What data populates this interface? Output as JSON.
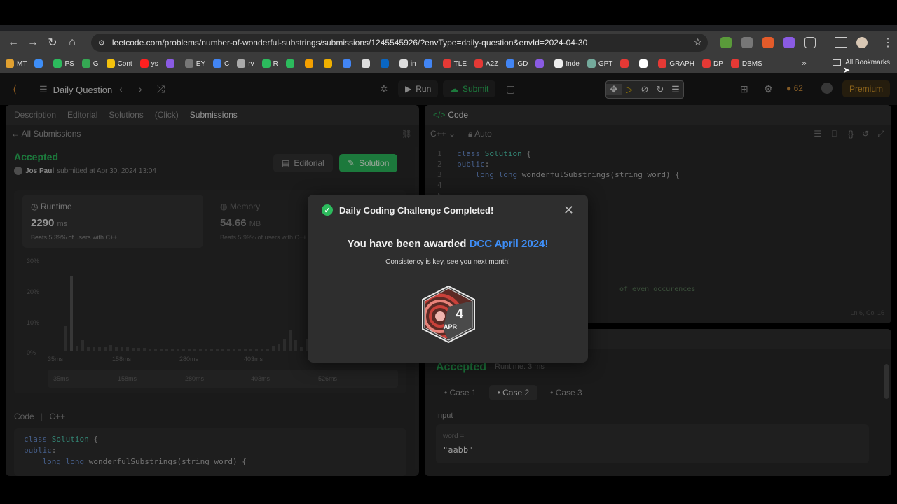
{
  "browser": {
    "url": "leetcode.com/problems/number-of-wonderful-substrings/submissions/1245545926/?envType=daily-question&envId=2024-04-30",
    "bookmarks": [
      "MT",
      "",
      "PS",
      "G",
      "Cont",
      "ys",
      "",
      "EY",
      "C",
      "rv",
      "R",
      "",
      "",
      "",
      "",
      "",
      "",
      "in",
      "",
      "TLE",
      "A2Z",
      "GD",
      "",
      "Inde",
      "GPT",
      "",
      "",
      "GRAPH",
      "DP",
      "DBMS"
    ],
    "all_bookmarks": "All Bookmarks"
  },
  "toolbar": {
    "daily_question": "Daily Question",
    "run": "Run",
    "submit": "Submit",
    "streak": "62",
    "premium": "Premium"
  },
  "left_panel": {
    "tabs": [
      "Description",
      "Editorial",
      "Solutions",
      "(Click)",
      "Submissions"
    ],
    "back": "All Submissions",
    "status": "Accepted",
    "user": "Jos Paul",
    "submitted": "submitted at Apr 30, 2024 13:04",
    "editorial_btn": "Editorial",
    "solution_btn": "Solution",
    "runtime": {
      "label": "Runtime",
      "value": "2290",
      "unit": "ms",
      "beats": "Beats 5.39% of users with C++"
    },
    "memory": {
      "label": "Memory",
      "value": "54.66",
      "unit": "MB",
      "beats": "Beats 5.99% of users with C++"
    },
    "chart_y": [
      "30%",
      "20%",
      "10%",
      "0%"
    ],
    "chart_x": [
      "35ms",
      "158ms",
      "280ms",
      "403ms"
    ],
    "mini_x": [
      "35ms",
      "158ms",
      "280ms",
      "403ms",
      "526ms"
    ],
    "code_label": "Code",
    "code_lang": "C++",
    "code": [
      "class Solution {",
      "public:",
      "    long long wonderfulSubstrings(string word) {"
    ]
  },
  "right_panel": {
    "tab": "Code",
    "lang": "C++",
    "auto": "Auto",
    "line_numbers": [
      "1",
      "2",
      "3",
      "4",
      "5"
    ],
    "code": [
      "class Solution {",
      "public:",
      "    long long wonderfulSubstrings(string word) {",
      "",
      ""
    ],
    "comment_fragment": "of even occurences",
    "cursor": "Ln 6, Col 16",
    "result_status": "Accepted",
    "result_runtime": "Runtime: 3 ms",
    "cases": [
      "Case 1",
      "Case 2",
      "Case 3"
    ],
    "input_label": "Input",
    "var": "word =",
    "value": "\"aabb\""
  },
  "modal": {
    "title": "Daily Coding Challenge Completed!",
    "awarded_prefix": "You have been awarded",
    "award_name": "DCC April 2024!",
    "subtitle": "Consistency is key, see you next month!",
    "badge_number": "4",
    "badge_month": "APR"
  }
}
